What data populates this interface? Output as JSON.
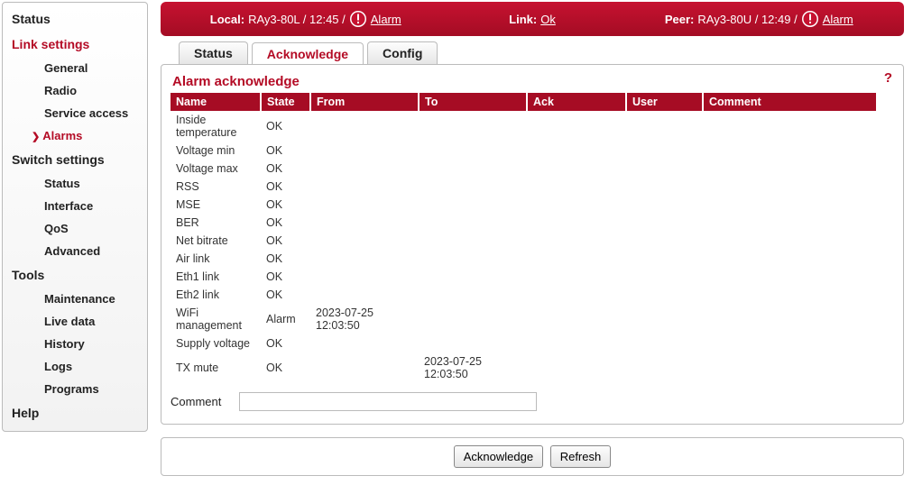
{
  "sidebar": {
    "status": "Status",
    "link_settings": "Link settings",
    "link_items": [
      "General",
      "Radio",
      "Service access",
      "Alarms"
    ],
    "switch_settings": "Switch settings",
    "switch_items": [
      "Status",
      "Interface",
      "QoS",
      "Advanced"
    ],
    "tools": "Tools",
    "tools_items": [
      "Maintenance",
      "Live data",
      "History",
      "Logs",
      "Programs"
    ],
    "help": "Help"
  },
  "topbar": {
    "local_label": "Local:",
    "local_value": "RAy3-80L / 12:45 /",
    "local_alarm": "Alarm",
    "link_label": "Link:",
    "link_value": "Ok",
    "peer_label": "Peer:",
    "peer_value": "RAy3-80U / 12:49 /",
    "peer_alarm": "Alarm"
  },
  "tabs": {
    "status": "Status",
    "acknowledge": "Acknowledge",
    "config": "Config"
  },
  "panel": {
    "title": "Alarm acknowledge",
    "help": "?",
    "columns": [
      "Name",
      "State",
      "From",
      "To",
      "Ack",
      "User",
      "Comment"
    ],
    "rows": [
      {
        "name": "Inside temperature",
        "state": "OK",
        "from": "",
        "to": "",
        "ack": "",
        "user": "",
        "comment": ""
      },
      {
        "name": "Voltage min",
        "state": "OK",
        "from": "",
        "to": "",
        "ack": "",
        "user": "",
        "comment": ""
      },
      {
        "name": "Voltage max",
        "state": "OK",
        "from": "",
        "to": "",
        "ack": "",
        "user": "",
        "comment": ""
      },
      {
        "name": "RSS",
        "state": "OK",
        "from": "",
        "to": "",
        "ack": "",
        "user": "",
        "comment": ""
      },
      {
        "name": "MSE",
        "state": "OK",
        "from": "",
        "to": "",
        "ack": "",
        "user": "",
        "comment": ""
      },
      {
        "name": "BER",
        "state": "OK",
        "from": "",
        "to": "",
        "ack": "",
        "user": "",
        "comment": ""
      },
      {
        "name": "Net bitrate",
        "state": "OK",
        "from": "",
        "to": "",
        "ack": "",
        "user": "",
        "comment": ""
      },
      {
        "name": "Air link",
        "state": "OK",
        "from": "",
        "to": "",
        "ack": "",
        "user": "",
        "comment": ""
      },
      {
        "name": "Eth1 link",
        "state": "OK",
        "from": "",
        "to": "",
        "ack": "",
        "user": "",
        "comment": ""
      },
      {
        "name": "Eth2 link",
        "state": "OK",
        "from": "",
        "to": "",
        "ack": "",
        "user": "",
        "comment": ""
      },
      {
        "name": "WiFi management",
        "state": "Alarm",
        "from": "2023-07-25 12:03:50",
        "to": "",
        "ack": "",
        "user": "",
        "comment": ""
      },
      {
        "name": "Supply voltage",
        "state": "OK",
        "from": "",
        "to": "",
        "ack": "",
        "user": "",
        "comment": ""
      },
      {
        "name": "TX mute",
        "state": "OK",
        "from": "",
        "to": "2023-07-25 12:03:50",
        "ack": "",
        "user": "",
        "comment": ""
      }
    ],
    "comment_label": "Comment",
    "comment_value": ""
  },
  "buttons": {
    "acknowledge": "Acknowledge",
    "refresh": "Refresh"
  }
}
